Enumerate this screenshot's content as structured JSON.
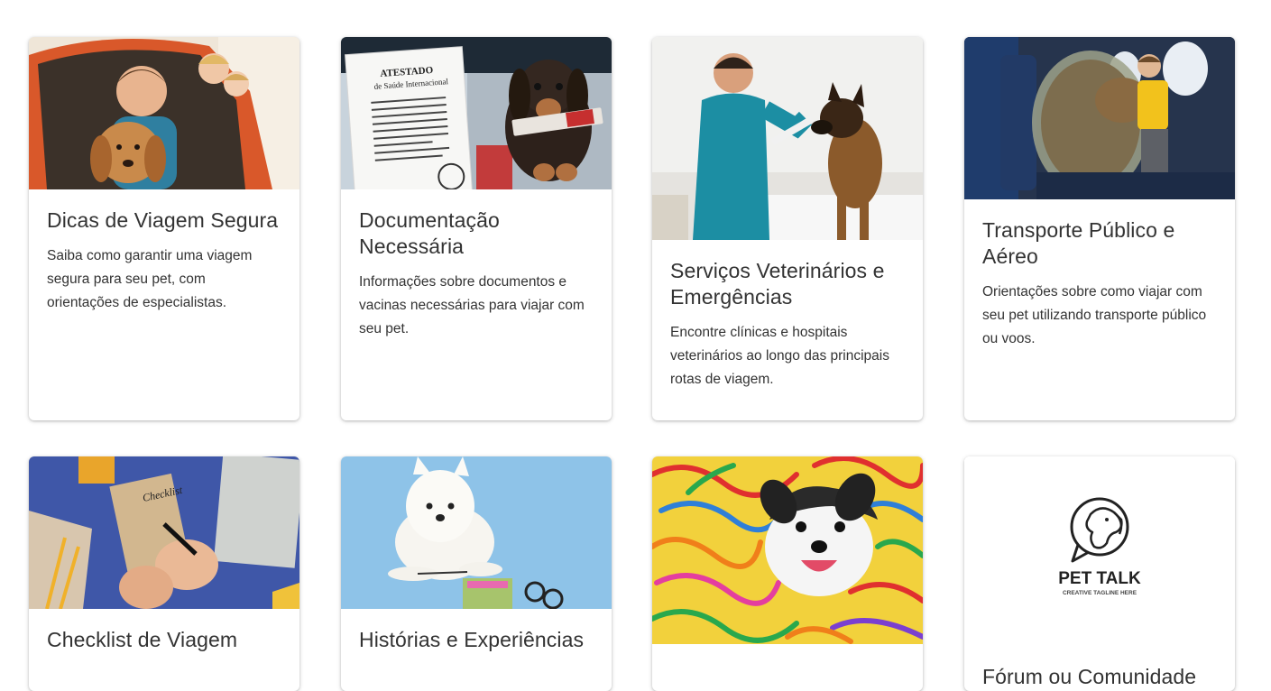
{
  "cards": [
    {
      "image_alt": "dog-in-car",
      "title": "Dicas de Viagem Segura",
      "description": "Saiba como garantir uma viagem segura para seu pet, com orientações de especialistas."
    },
    {
      "image_alt": "dog-with-certificate",
      "title": "Documentação Necessária",
      "description": "Informações sobre documentos e vacinas necessárias para viajar com seu pet.",
      "certificate_title": "ATESTADO",
      "certificate_subtitle": "de Saúde Internacional"
    },
    {
      "image_alt": "veterinarian-with-dog",
      "title": "Serviços Veterinários e Emergências",
      "description": "Encontre clínicas e hospitais veterinários ao longo das principais rotas de viagem."
    },
    {
      "image_alt": "dog-on-airplane",
      "title": "Transporte Público e Aéreo",
      "description": "Orientações sobre como viajar com seu pet utilizando transporte público ou voos."
    },
    {
      "image_alt": "checklist-notepad",
      "title": "Checklist de Viagem",
      "notepad_label": "Checklist"
    },
    {
      "image_alt": "white-dog-on-blue",
      "title": "Histórias e Experiências"
    },
    {
      "image_alt": "dog-in-streamers"
    },
    {
      "image_alt": "pet-talk-logo",
      "title": "Fórum ou Comunidade",
      "logo_name": "PET TALK",
      "logo_tagline": "CREATIVE TAGLINE HERE"
    }
  ]
}
